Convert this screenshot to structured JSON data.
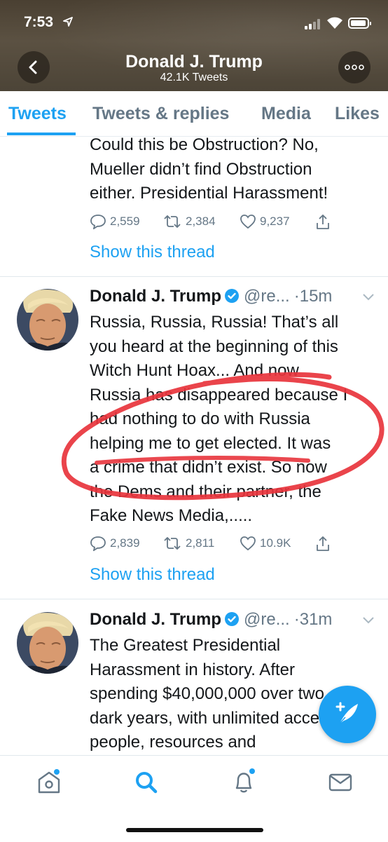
{
  "status_bar": {
    "time": "7:53"
  },
  "header": {
    "title": "Donald J. Trump",
    "subtitle": "42.1K Tweets"
  },
  "tabs": [
    {
      "label": "Tweets",
      "active": true
    },
    {
      "label": "Tweets & replies",
      "active": false
    },
    {
      "label": "Media",
      "active": false
    },
    {
      "label": "Likes",
      "active": false
    }
  ],
  "tweets": [
    {
      "text_lines": [
        "Could this be Obstruction? No,",
        "Mueller didn’t find Obstruction",
        "either. Presidential Harassment!"
      ],
      "replies": "2,559",
      "retweets": "2,384",
      "likes": "9,237",
      "show_thread": "Show this thread"
    },
    {
      "author": "Donald J. Trump",
      "handle": "@re...",
      "time": "·15m",
      "text_lines": [
        "Russia, Russia, Russia! That’s all",
        "you heard at the beginning of this",
        "Witch Hunt Hoax... And now",
        "Russia has disappeared because I",
        "had nothing to do with Russia",
        "helping me to get elected. It was",
        "a crime that didn’t exist. So now",
        "the Dems and their partner, the",
        "Fake News Media,....."
      ],
      "replies": "2,839",
      "retweets": "2,811",
      "likes": "10.9K",
      "show_thread": "Show this thread"
    },
    {
      "author": "Donald J. Trump",
      "handle": "@re...",
      "time": "·31m",
      "text_lines": [
        "The Greatest Presidential",
        "Harassment in history. After",
        "spending $40,000,000 over two",
        "dark years, with unlimited access,",
        "people, resources and"
      ]
    }
  ],
  "colors": {
    "accent": "#1da1f2",
    "annotation_red": "#e8343c",
    "secondary_text": "#657786"
  },
  "icons": [
    "back-arrow-icon",
    "more-icon",
    "verified-icon",
    "reply-icon",
    "retweet-icon",
    "like-icon",
    "share-icon",
    "compose-icon",
    "home-icon",
    "search-icon",
    "notifications-icon",
    "messages-icon"
  ]
}
